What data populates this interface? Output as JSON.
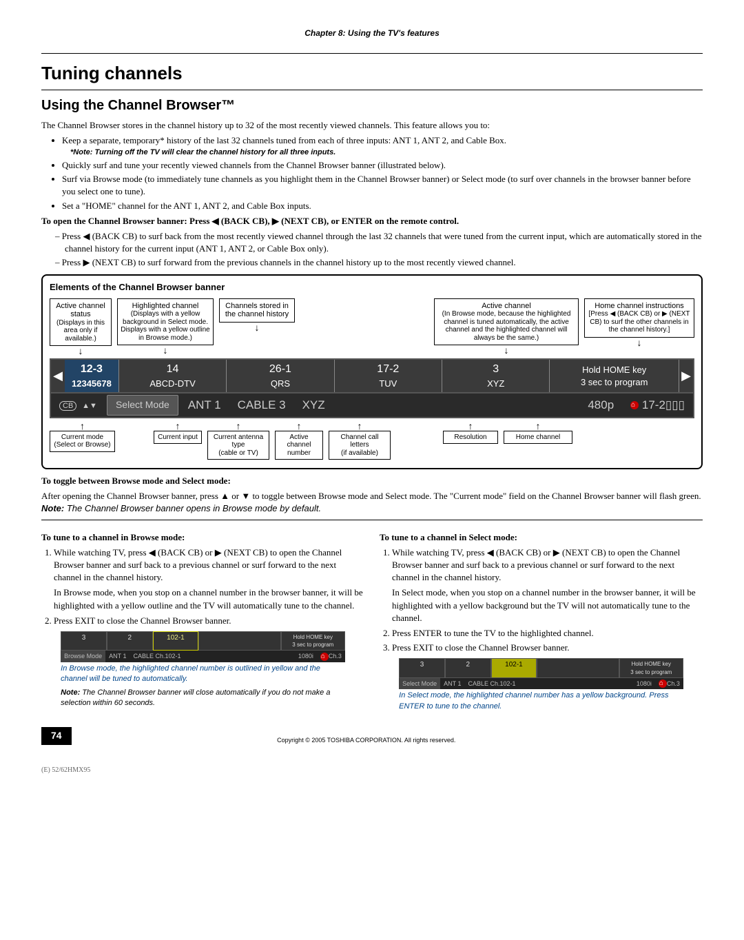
{
  "chapter": "Chapter 8: Using the TV's features",
  "h1": "Tuning channels",
  "h2": "Using the Channel Browser™",
  "intro": "The Channel Browser stores in the channel history up to 32 of the most recently viewed channels. This feature allows you to:",
  "bullets": {
    "b1": "Keep a separate, temporary* history of the last 32 channels tuned from each of three inputs: ANT 1, ANT 2, and Cable Box.",
    "b1note": "*Note: Turning off the TV will clear the channel history for all three inputs.",
    "b2": "Quickly surf and tune your recently viewed channels from the Channel Browser banner (illustrated below).",
    "b3": "Surf via Browse mode (to immediately tune channels as you highlight them in the Channel Browser banner) or Select mode (to surf over channels in the browser banner before you select one to tune).",
    "b4": "Set a \"HOME\" channel for the ANT 1, ANT 2, and Cable Box inputs."
  },
  "open_instr": "To open the Channel Browser banner: Press ◀ (BACK CB), ▶ (NEXT CB), or ENTER on the remote control.",
  "dash": {
    "d1": "– Press ◀ (BACK CB) to surf back from the most recently viewed channel through the last 32 channels that were tuned from the current input, which are automatically stored in the channel history for the current input (ANT 1, ANT 2, or Cable Box only).",
    "d2": "– Press ▶ (NEXT CB) to surf forward from the previous channels in the channel history up to the most recently viewed channel."
  },
  "diagram": {
    "title": "Elements of the Channel Browser banner",
    "top_callouts": {
      "c1_title": "Active channel status",
      "c1_body": "(Displays in this area only if available.)",
      "c2_title": "Highlighted channel",
      "c2_body": "(Displays with a yellow background in Select mode. Displays with a yellow outline in Browse mode.)",
      "c3_title": "Channels stored in the channel history",
      "c4_title": "Active channel",
      "c4_body": "(In Browse mode, because the highlighted channel is tuned automatically, the active channel and the highlighted channel will always be the same.)",
      "c5_title": "Home channel instructions",
      "c5_body": "[Press ◀ (BACK CB) or ▶ (NEXT CB) to surf the other channels in the channel history.]"
    },
    "banner": {
      "cell1_top": "12-3",
      "cell1_bot": "12345678",
      "cell2_top": "14",
      "cell2_bot": "ABCD-DTV",
      "cell3_top": "26-1",
      "cell3_bot": "QRS",
      "cell4_top": "17-2",
      "cell4_bot": "TUV",
      "cell5_top": "3",
      "cell5_bot": "XYZ",
      "cell6_top": "Hold HOME key",
      "cell6_bot": "3 sec to program"
    },
    "status": {
      "cb": "CB",
      "mode": "Select Mode",
      "input": "ANT 1",
      "antenna": "CABLE 3",
      "call": "XYZ",
      "res": "480p",
      "home": "17-2"
    },
    "bottom_callouts": {
      "b1": "Current mode",
      "b1b": "(Select or Browse)",
      "b2": "Current input",
      "b3": "Current antenna type",
      "b3b": "(cable or TV)",
      "b4": "Active channel number",
      "b5": "Channel call letters",
      "b5b": "(if available)",
      "b6": "Resolution",
      "b7": "Home channel"
    }
  },
  "toggle_head": "To toggle between Browse mode and Select mode:",
  "toggle_body_a": "After opening the Channel Browser banner, press ▲ or ▼ to toggle between Browse mode and Select mode.  The \"Current mode\" field on the Channel Browser banner will flash green.  ",
  "toggle_note_label": "Note:",
  "toggle_note": " The Channel Browser banner opens in Browse mode by default.",
  "browse": {
    "head": "To tune to a channel in Browse mode:",
    "s1": "While watching TV, press ◀ (BACK CB) or ▶ (NEXT CB)  to open the Channel Browser banner and surf back to a previous channel or surf forward to the next channel in the channel history.",
    "s1b": "In Browse mode, when you stop on a channel number in the browser banner, it will be highlighted with a yellow outline and the TV will automatically tune to the channel.",
    "s2": "Press EXIT to close the Channel Browser banner.",
    "caption": "In Browse mode, the highlighted channel number is outlined in yellow and the channel will be tuned to automatically.",
    "note_label": "Note:",
    "note": " The Channel Browser banner will close automatically if you do not make a selection within 60 seconds."
  },
  "select": {
    "head": "To tune to a channel in Select mode:",
    "s1": "While watching TV, press ◀ (BACK CB) or ▶ (NEXT CB)  to open the Channel Browser banner and surf back to a previous channel or surf forward to the next channel in the channel history.",
    "s1b": "In Select mode, when you stop on a channel number in the browser banner, it will be highlighted with a yellow background but the TV will not automatically tune to the channel.",
    "s2": "Press ENTER to tune the TV to the highlighted channel.",
    "s3": "Press EXIT to close the Channel Browser banner.",
    "caption": "In Select mode, the highlighted channel number has a yellow background. Press ENTER to tune to the channel."
  },
  "mini": {
    "c1": "3",
    "c2": "2",
    "c3": "102-1",
    "hold": "Hold HOME key\n3 sec to program",
    "mode_b": "Browse Mode",
    "mode_s": "Select Mode",
    "ant": "ANT 1",
    "info": "CABLE  Ch.102-1",
    "res": "1080i",
    "home": "Ch.3"
  },
  "page_number": "74",
  "copyright": "Copyright © 2005 TOSHIBA CORPORATION. All rights reserved.",
  "doc_code": "(E) 52/62HMX95"
}
